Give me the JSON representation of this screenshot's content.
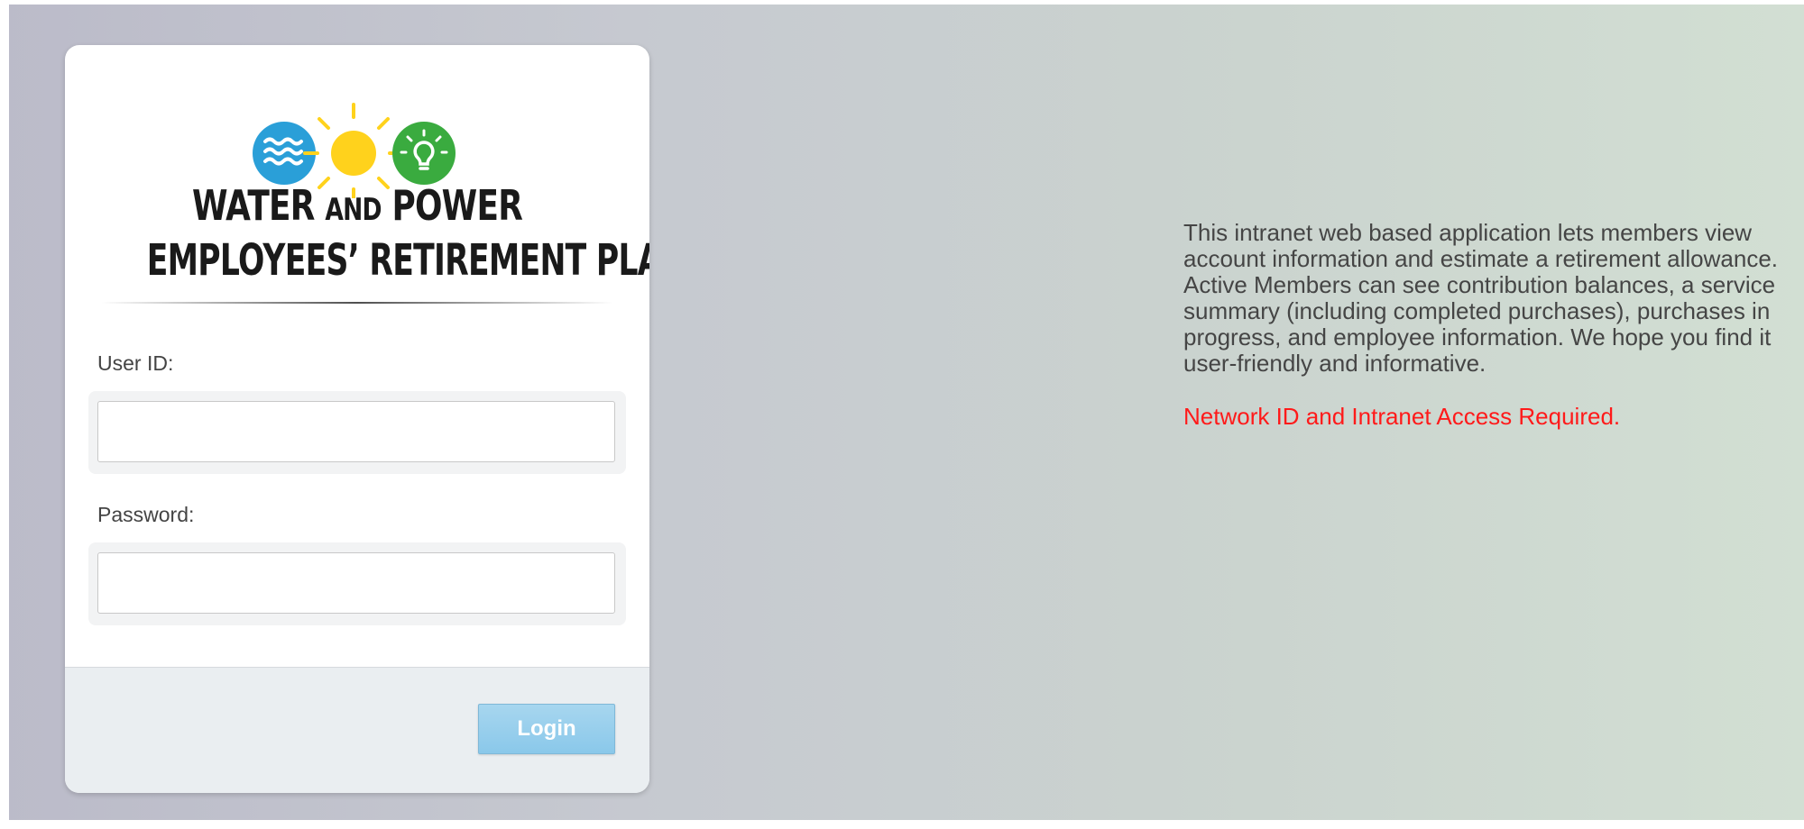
{
  "logo": {
    "line1_a": "WATER ",
    "line1_b": "AND",
    "line1_c": " POWER",
    "line2": "EMPLOYEES’ RETIREMENT PLAN",
    "icons": [
      "water-waves-icon",
      "sun-icon",
      "lightbulb-icon"
    ],
    "colors": {
      "water": "#2a9fd8",
      "sun": "#ffd21c",
      "bulb": "#3aab3f"
    }
  },
  "form": {
    "userid_label": "User ID:",
    "userid_value": "",
    "password_label": "Password:",
    "password_value": "",
    "login_label": "Login"
  },
  "info": {
    "description": "This intranet web based application lets members view account information and estimate a retirement allowance. Active Members can see contribution balances, a service summary (including completed purchases), purchases in progress, and employee information. We hope you find it user-friendly and informative.",
    "notice": "Network ID and Intranet Access Required.",
    "notice_color": "#ff1a1a"
  }
}
